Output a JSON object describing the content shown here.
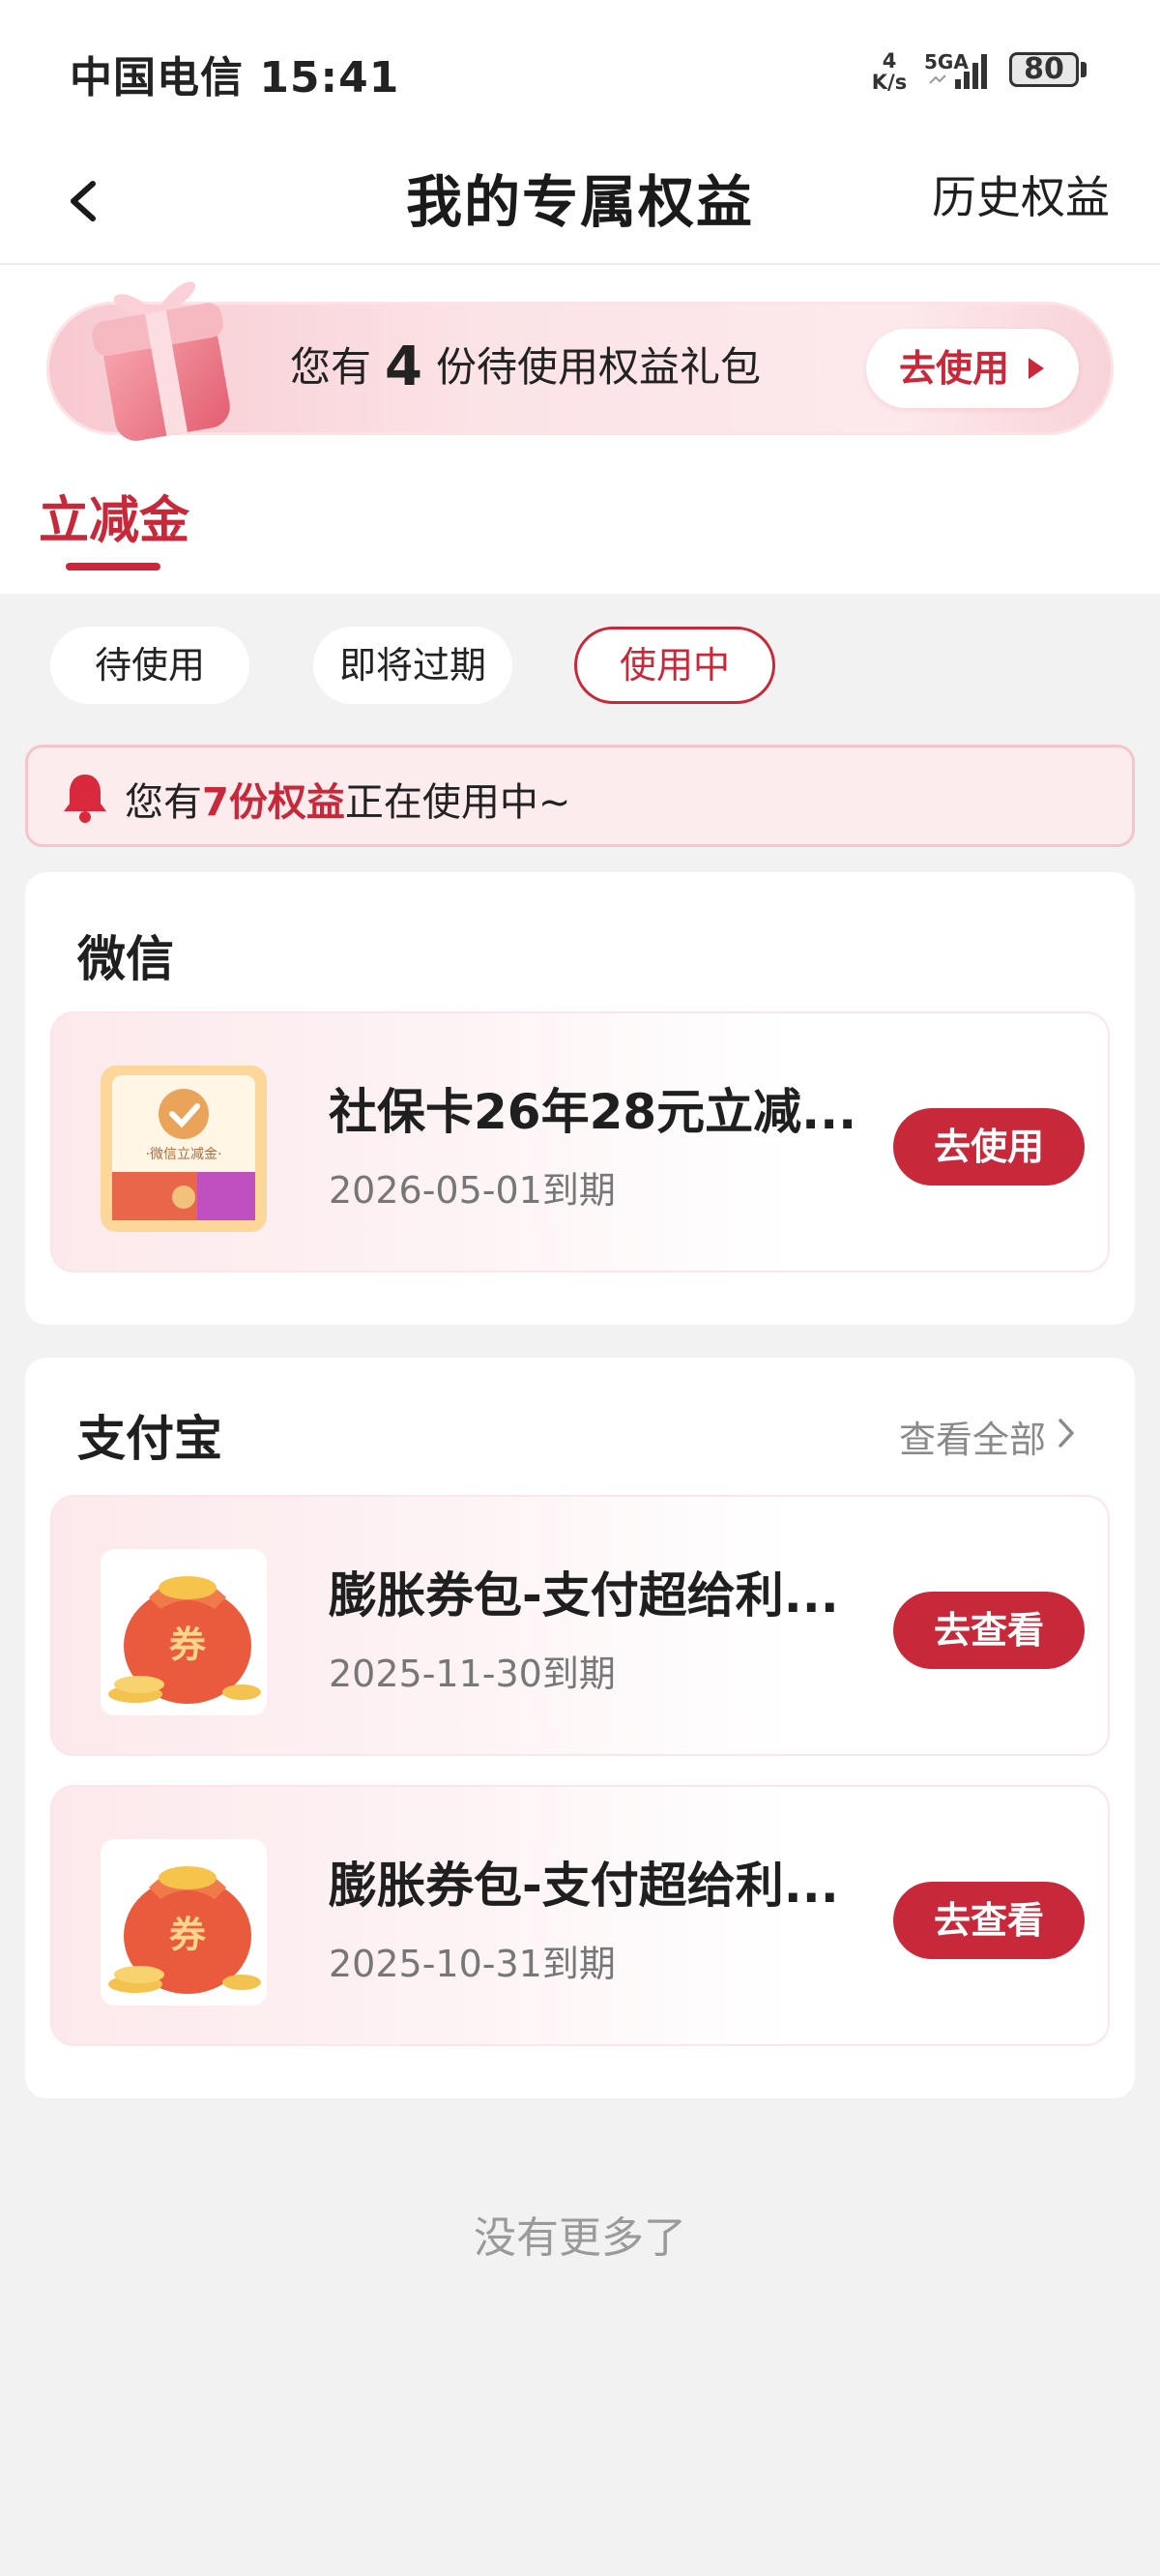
{
  "status_bar": {
    "carrier_time": "中国电信 15:41",
    "net_speed_value": "4",
    "net_speed_unit": "K/s",
    "signal_label": "5GA",
    "battery": "80"
  },
  "header": {
    "title": "我的专属权益",
    "history_link": "历史权益"
  },
  "gift_banner": {
    "prefix": "您有",
    "count": "4",
    "suffix": "份待使用权益礼包",
    "button_label": "去使用"
  },
  "category_tab": {
    "label": "立减金"
  },
  "filter_chips": [
    {
      "label": "待使用"
    },
    {
      "label": "即将过期"
    },
    {
      "label": "使用中",
      "active": true
    }
  ],
  "notice": {
    "prefix": "您有",
    "highlight": "7份权益",
    "suffix": "正在使用中~"
  },
  "sections": [
    {
      "title": "微信",
      "items": [
        {
          "title": "社保卡26年28元立减...",
          "date": "2026-05-01到期",
          "button_label": "去使用",
          "icon": "wechat-discount-card-icon",
          "icon_text": "·微信立减金·"
        }
      ]
    },
    {
      "title": "支付宝",
      "see_all": "查看全部",
      "items": [
        {
          "title": "膨胀券包-支付超给利...",
          "date": "2025-11-30到期",
          "button_label": "去查看",
          "icon": "coupon-bag-icon",
          "icon_text": "券"
        },
        {
          "title": "膨胀券包-支付超给利...",
          "date": "2025-10-31到期",
          "button_label": "去查看",
          "icon": "coupon-bag-icon",
          "icon_text": "券"
        }
      ]
    }
  ],
  "footer": {
    "no_more": "没有更多了"
  },
  "colors": {
    "accent": "#c8293a",
    "page_bg": "#f2f2f2",
    "notice_bg": "#fdecee"
  }
}
